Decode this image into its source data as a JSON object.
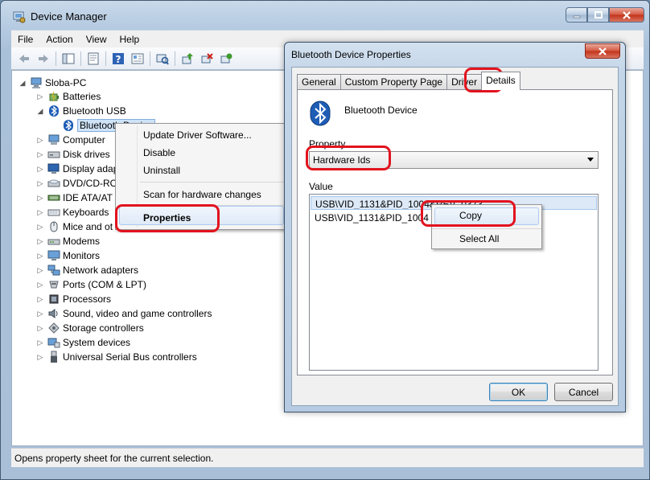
{
  "main_window": {
    "title": "Device Manager",
    "menu": [
      "File",
      "Action",
      "View",
      "Help"
    ],
    "status_text": "Opens property sheet for the current selection."
  },
  "tree": {
    "root": "Sloba-PC",
    "items": [
      {
        "label": "Batteries",
        "icon": "battery-icon"
      },
      {
        "label": "Bluetooth USB",
        "icon": "bluetooth-icon"
      },
      {
        "label": "Bluetooth Device",
        "icon": "bluetooth-icon"
      },
      {
        "label": "Computer",
        "icon": "computer-icon"
      },
      {
        "label": "Disk drives",
        "icon": "disk-drive-icon"
      },
      {
        "label": "Display adap",
        "icon": "display-adapter-icon"
      },
      {
        "label": "DVD/CD-RO",
        "icon": "dvd-drive-icon"
      },
      {
        "label": "IDE ATA/AT",
        "icon": "ide-controller-icon"
      },
      {
        "label": "Keyboards",
        "icon": "keyboard-icon"
      },
      {
        "label": "Mice and ot",
        "icon": "mouse-icon"
      },
      {
        "label": "Modems",
        "icon": "modem-icon"
      },
      {
        "label": "Monitors",
        "icon": "monitor-icon"
      },
      {
        "label": "Network adapters",
        "icon": "network-adapter-icon"
      },
      {
        "label": "Ports (COM & LPT)",
        "icon": "port-icon"
      },
      {
        "label": "Processors",
        "icon": "processor-icon"
      },
      {
        "label": "Sound, video and game controllers",
        "icon": "sound-icon"
      },
      {
        "label": "Storage controllers",
        "icon": "storage-controller-icon"
      },
      {
        "label": "System devices",
        "icon": "system-devices-icon"
      },
      {
        "label": "Universal Serial Bus controllers",
        "icon": "usb-icon"
      }
    ]
  },
  "context_menu": {
    "items": [
      "Update Driver Software...",
      "Disable",
      "Uninstall",
      "Scan for hardware changes",
      "Properties"
    ]
  },
  "dialog": {
    "title": "Bluetooth Device Properties",
    "tabs": [
      "General",
      "Custom Property Page",
      "Driver",
      "Details"
    ],
    "active_tab": "Details",
    "device_name": "Bluetooth Device",
    "property_label": "Property",
    "property_value": "Hardware Ids",
    "value_label": "Value",
    "values": [
      "USB\\VID_1131&PID_1004&REV_0373",
      "USB\\VID_1131&PID_1004"
    ],
    "ok_label": "OK",
    "cancel_label": "Cancel"
  },
  "copy_menu": {
    "items": [
      "Copy",
      "Select All"
    ]
  },
  "colors": {
    "highlight_ring": "#e2131e",
    "window_frame": "#b7cce2",
    "selection": "#cfe3f8"
  }
}
